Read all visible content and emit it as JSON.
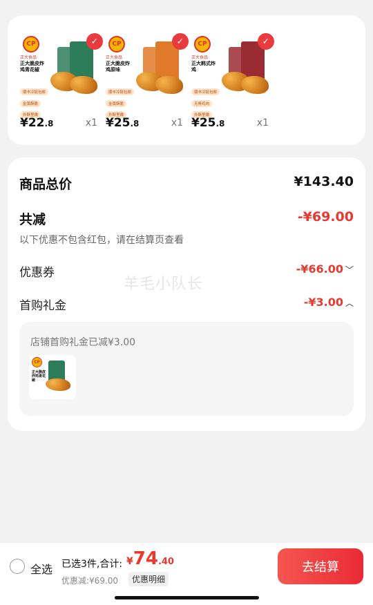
{
  "products": [
    {
      "brand": "正大食品",
      "name": "正大脆皮炸鸡青花椒",
      "tags": [
        "顺丰冷链包邮",
        "金黄酥脆",
        "外酥里嫩"
      ],
      "price_int": "¥22",
      "price_dec": ".8",
      "qty": "x1",
      "pack_color": "#2e7d5a"
    },
    {
      "brand": "正大食品",
      "name": "正大脆皮炸鸡原味",
      "tags": [
        "顺丰冷链包邮",
        "金黄酥脆",
        "外酥里嫩"
      ],
      "price_int": "¥25",
      "price_dec": ".8",
      "qty": "x1",
      "pack_color": "#e07a2a"
    },
    {
      "brand": "正大食品",
      "name": "正大韩式炸鸡",
      "tags": [
        "顺丰冷链包邮",
        "无骨鸡肉",
        "外酥里嫩"
      ],
      "price_int": "¥25",
      "price_dec": ".8",
      "qty": "x1",
      "pack_color": "#9b2b32"
    }
  ],
  "logo_text": "CP",
  "check_glyph": "✓",
  "summary": {
    "total_label": "商品总价",
    "total_value": "¥143.40",
    "reduce_label": "共减",
    "reduce_value": "-¥69.00",
    "reduce_note": "以下优惠不包含红包，请在结算页查看",
    "coupon_label": "优惠券",
    "coupon_value": "-¥66.00",
    "gift_label": "首购礼金",
    "gift_value": "-¥3.00",
    "gift_note": "店铺首购礼金已减¥3.00",
    "watermark": "羊毛小队长"
  },
  "bottom": {
    "select_all": "全选",
    "selected_text": "已选3件,合计:",
    "total_yen": "¥",
    "total_int": "74",
    "total_dec": ".40",
    "saved": "优惠减:¥69.00",
    "detail": "优惠明细",
    "checkout": "去结算"
  },
  "colors": {
    "accent": "#e8392f",
    "button": "#ea2b35"
  }
}
